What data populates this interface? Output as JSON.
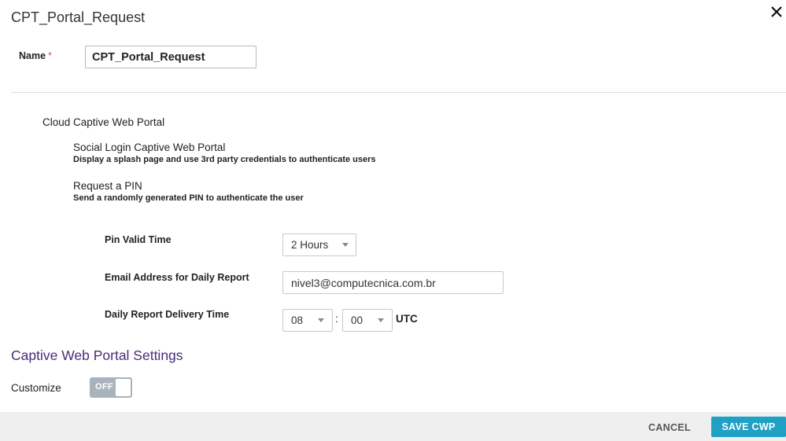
{
  "dialog": {
    "title": "CPT_Portal_Request",
    "close_icon": "close-icon"
  },
  "name_field": {
    "label": "Name",
    "required_marker": "*",
    "value": "CPT_Portal_Request"
  },
  "cloud_cwp": {
    "title": "Cloud Captive Web Portal",
    "options": [
      {
        "title": "Social Login Captive Web Portal",
        "description": "Display a splash page and use 3rd party credentials to authenticate users"
      },
      {
        "title": "Request a PIN",
        "description": "Send a randomly generated PIN to authenticate the user"
      }
    ]
  },
  "pin_settings": {
    "pin_valid_time": {
      "label": "Pin Valid Time",
      "value": "2 Hours"
    },
    "email": {
      "label": "Email Address for Daily Report",
      "value": "nivel3@computecnica.com.br"
    },
    "delivery_time": {
      "label": "Daily Report Delivery Time",
      "hour": "08",
      "minute": "00",
      "separator": ":",
      "timezone": "UTC"
    }
  },
  "cwp_settings": {
    "title": "Captive Web Portal Settings",
    "customize_label": "Customize",
    "customize_toggle": "OFF"
  },
  "footer": {
    "cancel_label": "CANCEL",
    "save_label": "SAVE CWP"
  },
  "colors": {
    "heading_purple": "#4a2a7a",
    "primary_button": "#1fa0c4",
    "toggle_off": "#a9b3bc",
    "required_star": "#d9534f"
  }
}
